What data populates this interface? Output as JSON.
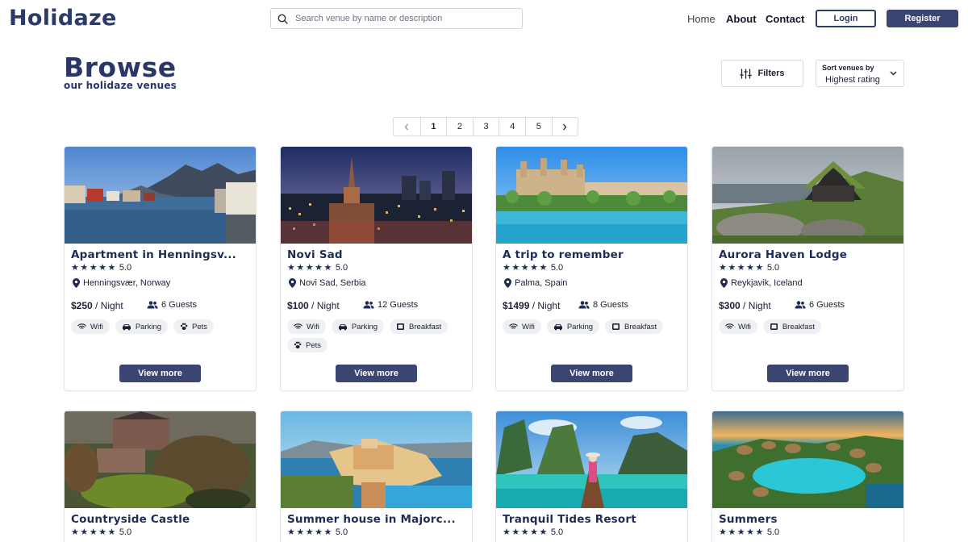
{
  "header": {
    "logo": "Holidaze",
    "search_placeholder": "Search venue by name or description",
    "nav": {
      "home": "Home",
      "about": "About",
      "contact": "Contact"
    },
    "login": "Login",
    "register": "Register"
  },
  "browse": {
    "title": "Browse",
    "subtitle": "our holidaze venues",
    "filters_label": "Filters",
    "sort_label": "Sort venues by",
    "sort_value": "Highest rating"
  },
  "pagination": {
    "prev": "‹",
    "pages": [
      "1",
      "2",
      "3",
      "4",
      "5"
    ],
    "active": "1",
    "next": "›"
  },
  "venues": [
    {
      "name": "Apartment in Henningsv...",
      "rating": "5.0",
      "location": "Henningsvær, Norway",
      "price": "$250",
      "per": "/ Night",
      "guests": "6 Guests",
      "amenities": [
        "Wifi",
        "Parking",
        "Pets"
      ],
      "button": "View more"
    },
    {
      "name": "Novi Sad",
      "rating": "5.0",
      "location": "Novi Sad, Serbia",
      "price": "$100",
      "per": "/ Night",
      "guests": "12 Guests",
      "amenities": [
        "Wifi",
        "Parking",
        "Breakfast",
        "Pets"
      ],
      "button": "View more"
    },
    {
      "name": "A trip to remember",
      "rating": "5.0",
      "location": "Palma, Spain",
      "price": "$1499",
      "per": "/ Night",
      "guests": "8 Guests",
      "amenities": [
        "Wifi",
        "Parking",
        "Breakfast"
      ],
      "button": "View more"
    },
    {
      "name": "Aurora Haven Lodge",
      "rating": "5.0",
      "location": "Reykjavik, Iceland",
      "price": "$300",
      "per": "/ Night",
      "guests": "6 Guests",
      "amenities": [
        "Wifi",
        "Breakfast"
      ],
      "button": "View more"
    },
    {
      "name": "Countryside Castle",
      "rating": "5.0"
    },
    {
      "name": "Summer house in Majorc...",
      "rating": "5.0"
    },
    {
      "name": "Tranquil Tides Resort",
      "rating": "5.0"
    },
    {
      "name": "Summers",
      "rating": "5.0"
    }
  ],
  "icons": [
    "search-icon",
    "sliders-icon",
    "chevron-down-icon",
    "chevron-left-icon",
    "chevron-right-icon",
    "location-pin-icon",
    "users-icon",
    "wifi-icon",
    "car-icon",
    "paw-icon",
    "breakfast-icon",
    "star-icon"
  ],
  "colors": {
    "brand": "#2c3a66",
    "button": "#3a4572",
    "chip": "#eef0f4"
  }
}
